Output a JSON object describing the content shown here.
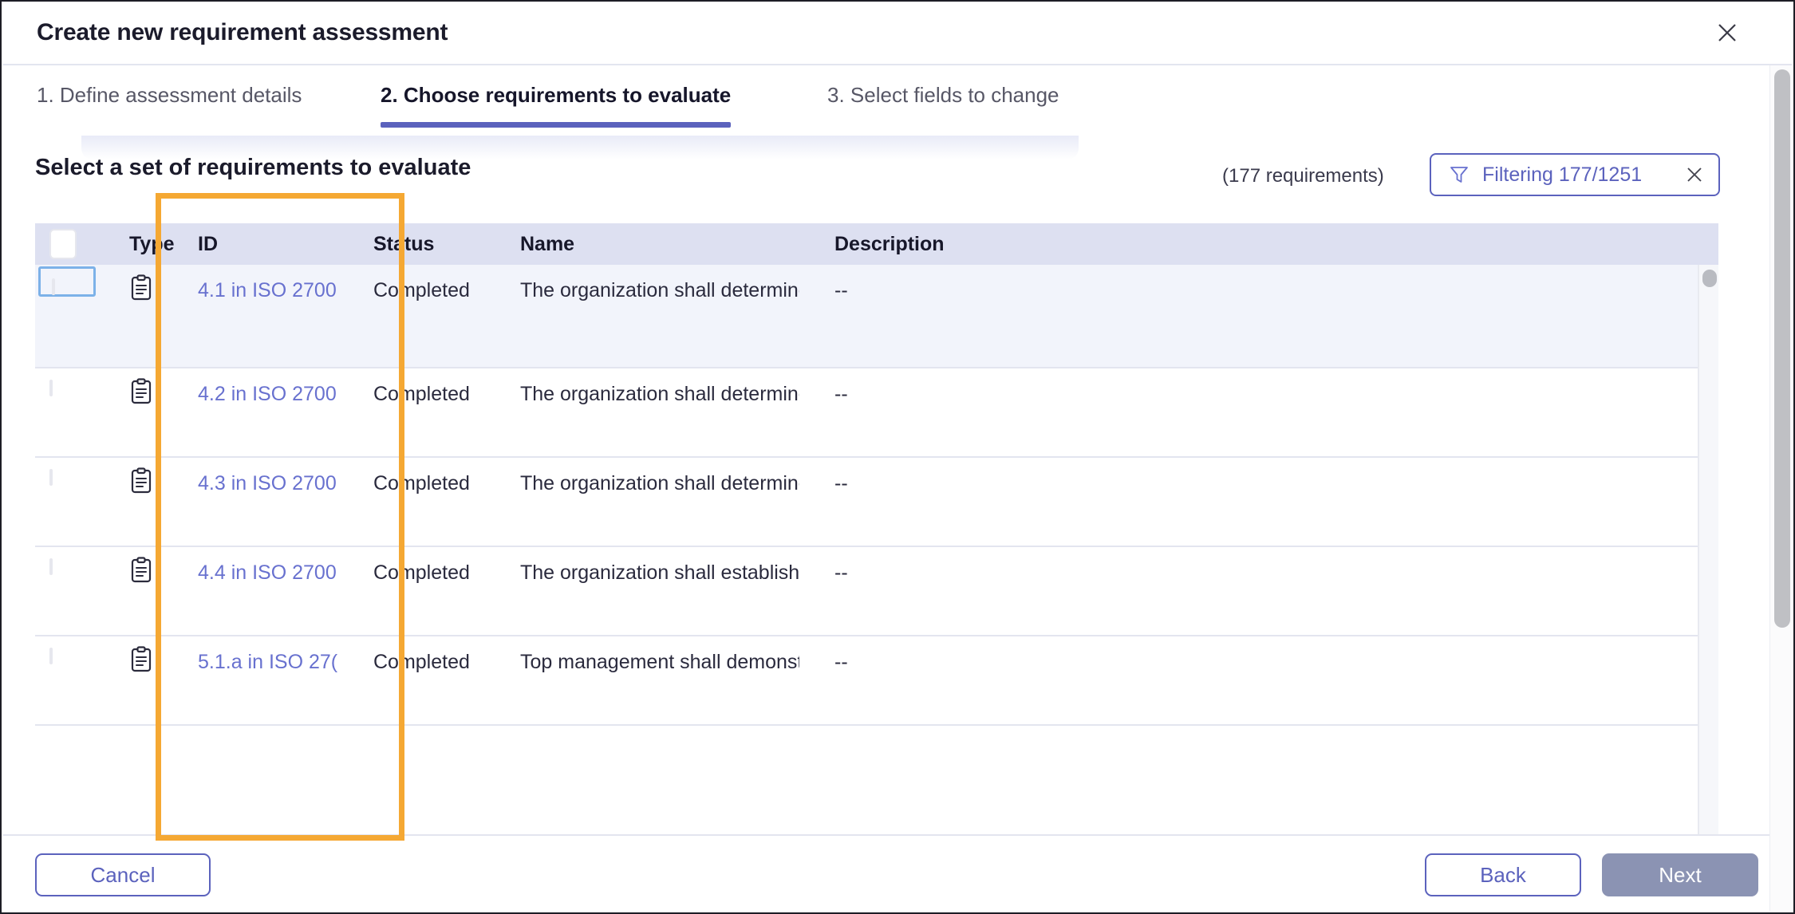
{
  "dialog": {
    "title": "Create new requirement assessment",
    "close_icon": "close-icon"
  },
  "tabs": [
    {
      "label": "1. Define assessment details",
      "active": false
    },
    {
      "label": "2. Choose requirements to evaluate",
      "active": true
    },
    {
      "label": "3. Select fields to change",
      "active": false
    }
  ],
  "section": {
    "heading": "Select a set of requirements to evaluate",
    "count_label": "(177 requirements)"
  },
  "filter": {
    "icon": "funnel-icon",
    "label": "Filtering 177/1251",
    "clear_icon": "close-icon"
  },
  "table": {
    "columns": [
      "Type",
      "ID",
      "Status",
      "Name",
      "Description"
    ],
    "rows": [
      {
        "type_icon": "clipboard-icon",
        "id": "4.1 in ISO 2700",
        "status": "Completed",
        "name": "The organization shall determine",
        "description": "--",
        "selected": true
      },
      {
        "type_icon": "clipboard-icon",
        "id": "4.2 in ISO 2700",
        "status": "Completed",
        "name": "The organization shall determine",
        "description": "--",
        "selected": false
      },
      {
        "type_icon": "clipboard-icon",
        "id": "4.3 in ISO 2700",
        "status": "Completed",
        "name": "The organization shall determine",
        "description": "--",
        "selected": false
      },
      {
        "type_icon": "clipboard-icon",
        "id": "4.4 in ISO 2700",
        "status": "Completed",
        "name": "The organization shall establish, i",
        "description": "--",
        "selected": false
      },
      {
        "type_icon": "clipboard-icon",
        "id": "5.1.a in ISO 27(",
        "status": "Completed",
        "name": "Top management shall demonstr",
        "description": "--",
        "selected": false
      }
    ]
  },
  "footer": {
    "cancel": "Cancel",
    "back": "Back",
    "next": "Next"
  },
  "colors": {
    "accent": "#5b62bd",
    "link": "#6871cf",
    "header_row": "#dde0f1",
    "selected_row": "#f2f4fb",
    "annotation": "#f5a833",
    "next_disabled": "#8b93b3"
  }
}
